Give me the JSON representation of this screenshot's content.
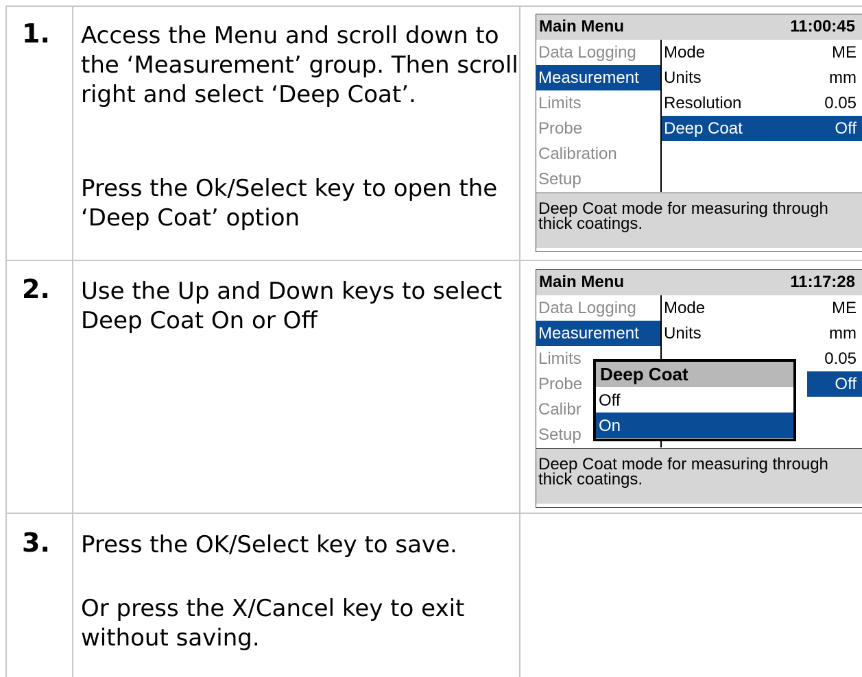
{
  "steps": [
    {
      "number": "1.",
      "paragraphs": [
        "Access the Menu and scroll down to the ‘Measurement’ group. Then scroll right and select ‘Deep Coat’.",
        "Press the Ok/Select key to open the ‘Deep Coat’ option"
      ]
    },
    {
      "number": "2.",
      "paragraphs": [
        "Use the Up and Down keys to select Deep Coat On or Off"
      ]
    },
    {
      "number": "3.",
      "paragraphs": [
        "Press the OK/Select key to save.",
        "Or press the X/Cancel key to exit without saving."
      ]
    }
  ],
  "screen1": {
    "title": "Main Menu",
    "clock": "11:00:45",
    "menu": [
      "Data Logging",
      "Measurement",
      "Limits",
      "Probe",
      "Calibration",
      "Setup"
    ],
    "selected_menu": "Measurement",
    "options": [
      {
        "label": "Mode",
        "value": "ME"
      },
      {
        "label": "Units",
        "value": "mm"
      },
      {
        "label": "Resolution",
        "value": "0.05"
      },
      {
        "label": "Deep Coat",
        "value": "Off"
      }
    ],
    "selected_option": "Deep Coat",
    "footer": "Deep Coat mode for measuring through thick coatings."
  },
  "screen2": {
    "title": "Main Menu",
    "clock": "11:17:28",
    "menu": [
      "Data Logging",
      "Measurement",
      "Limits",
      "Probe",
      "Calibr",
      "Setup"
    ],
    "selected_menu": "Measurement",
    "options": [
      {
        "label": "Mode",
        "value": "ME"
      },
      {
        "label": "Units",
        "value": "mm"
      },
      {
        "label": "",
        "value": "0.05"
      },
      {
        "label": "",
        "value": "Off"
      }
    ],
    "popup": {
      "title": "Deep Coat",
      "choices": [
        "Off",
        "On"
      ],
      "selected": "On"
    },
    "footer": "Deep Coat mode for measuring through thick coatings."
  },
  "colors": {
    "highlight": "#0a4d96",
    "header_bg": "#d6d6d6",
    "inactive_text": "#8a8a8a",
    "grid_line": "#c8c8c8"
  }
}
